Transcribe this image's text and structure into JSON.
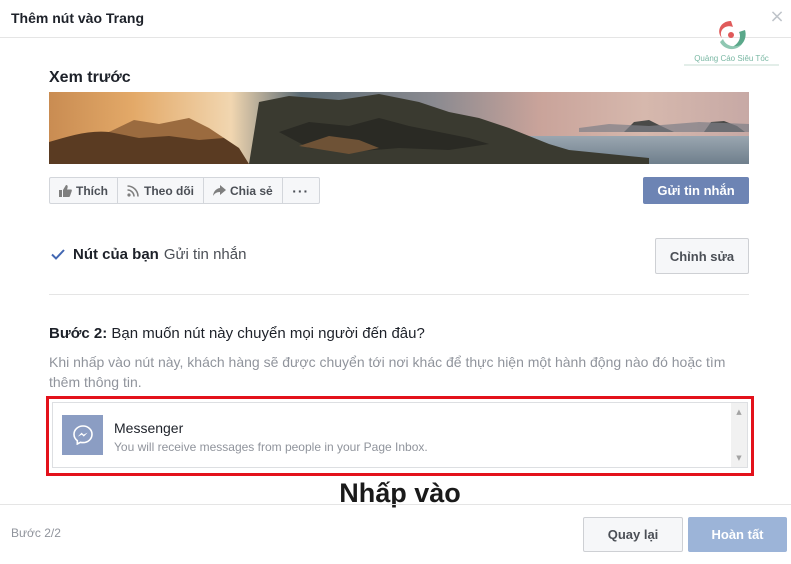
{
  "dialog": {
    "title": "Thêm nút vào Trang",
    "close_glyph": "×"
  },
  "watermark": {
    "text": "Quảng Cáo Siêu Tốc"
  },
  "preview": {
    "title": "Xem trước",
    "actions": [
      {
        "label": "Thích",
        "icon": "thumbs-up-icon"
      },
      {
        "label": "Theo dõi",
        "icon": "follow-rss-icon"
      },
      {
        "label": "Chia sẻ",
        "icon": "share-arrow-icon"
      }
    ],
    "more_glyph": "···",
    "message_button": "Gửi tin nhắn"
  },
  "your_button": {
    "label": "Nút của bạn",
    "value": "Gửi tin nhắn",
    "edit": "Chỉnh sửa"
  },
  "step2": {
    "prefix": "Bước 2:",
    "question": "Bạn muốn nút này chuyển mọi người đến đâu?",
    "description": "Khi nhấp vào nút này, khách hàng sẽ được chuyển tới nơi khác để thực hiện một hành động nào đó hoặc tìm thêm thông tin."
  },
  "options": [
    {
      "title": "Messenger",
      "subtitle": "You will receive messages from people in your Page Inbox.",
      "icon": "messenger-icon"
    }
  ],
  "annotation": "Nhấp vào",
  "footer": {
    "step": "Bước 2/2",
    "back": "Quay lại",
    "finish": "Hoàn tất"
  },
  "colors": {
    "facebook_blue": "#6d84b4",
    "finish_disabled": "#9cb4d8",
    "highlight_red": "#e3111b",
    "check_blue": "#4267b2"
  }
}
